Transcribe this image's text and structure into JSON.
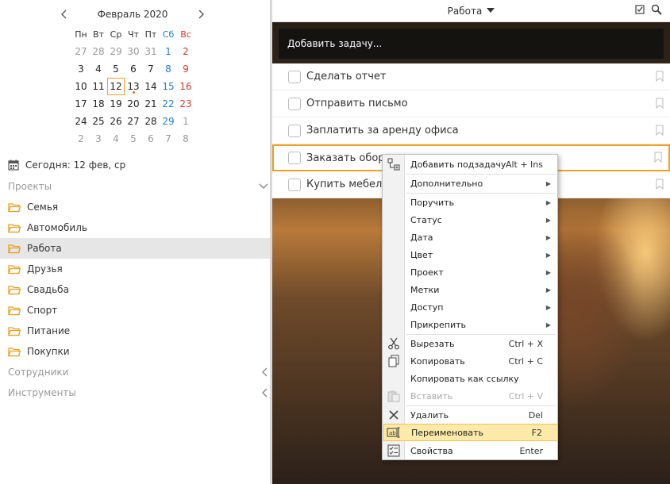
{
  "calendar": {
    "title": "Февраль 2020",
    "weekdays": [
      "Пн",
      "Вт",
      "Ср",
      "Чт",
      "Пт",
      "Сб",
      "Вс"
    ],
    "weeks": [
      [
        "27",
        "28",
        "29",
        "30",
        "31",
        "1",
        "2"
      ],
      [
        "3",
        "4",
        "5",
        "6",
        "7",
        "8",
        "9"
      ],
      [
        "10",
        "11",
        "12",
        "13",
        "14",
        "15",
        "16"
      ],
      [
        "17",
        "18",
        "19",
        "20",
        "21",
        "22",
        "23"
      ],
      [
        "24",
        "25",
        "26",
        "27",
        "28",
        "29",
        "1"
      ],
      [
        "2",
        "3",
        "4",
        "5",
        "6",
        "7",
        "8"
      ]
    ],
    "selected_day": "12"
  },
  "sidebar": {
    "today_label": "Сегодня: 12 фев, ср",
    "projects_header": "Проекты",
    "projects": [
      "Семья",
      "Автомобиль",
      "Работа",
      "Друзья",
      "Свадьба",
      "Спорт",
      "Питание",
      "Покупки"
    ],
    "active_project": "Работа",
    "employees_header": "Сотрудники",
    "tools_header": "Инструменты"
  },
  "topbar": {
    "title": "Работа"
  },
  "add_task": {
    "placeholder": "Добавить задачу..."
  },
  "tasks": [
    "Сделать отчет",
    "Отправить письмо",
    "Заплатить за аренду офиса",
    "Заказать обор",
    "Купить мебел"
  ],
  "context_menu": {
    "add_subtask": {
      "label": "Добавить подзадачу",
      "shortcut": "Alt + Ins"
    },
    "additional": "Дополнительно",
    "assign": "Поручить",
    "status": "Статус",
    "date": "Дата",
    "color": "Цвет",
    "project": "Проект",
    "tags": "Метки",
    "access": "Доступ",
    "attach": "Прикрепить",
    "cut": {
      "label": "Вырезать",
      "shortcut": "Ctrl + X"
    },
    "copy": {
      "label": "Копировать",
      "shortcut": "Ctrl + C"
    },
    "copy_link": "Копировать как ссылку",
    "paste": {
      "label": "Вставить",
      "shortcut": "Ctrl + V"
    },
    "delete": {
      "label": "Удалить",
      "shortcut": "Del"
    },
    "rename": {
      "label": "Переименовать",
      "shortcut": "F2"
    },
    "properties": {
      "label": "Свойства",
      "shortcut": "Enter"
    }
  },
  "colors": {
    "accent": "#f0a020",
    "saturday": "#1e7fc8",
    "sunday": "#d23a2a",
    "highlight": "#fde9a8"
  }
}
